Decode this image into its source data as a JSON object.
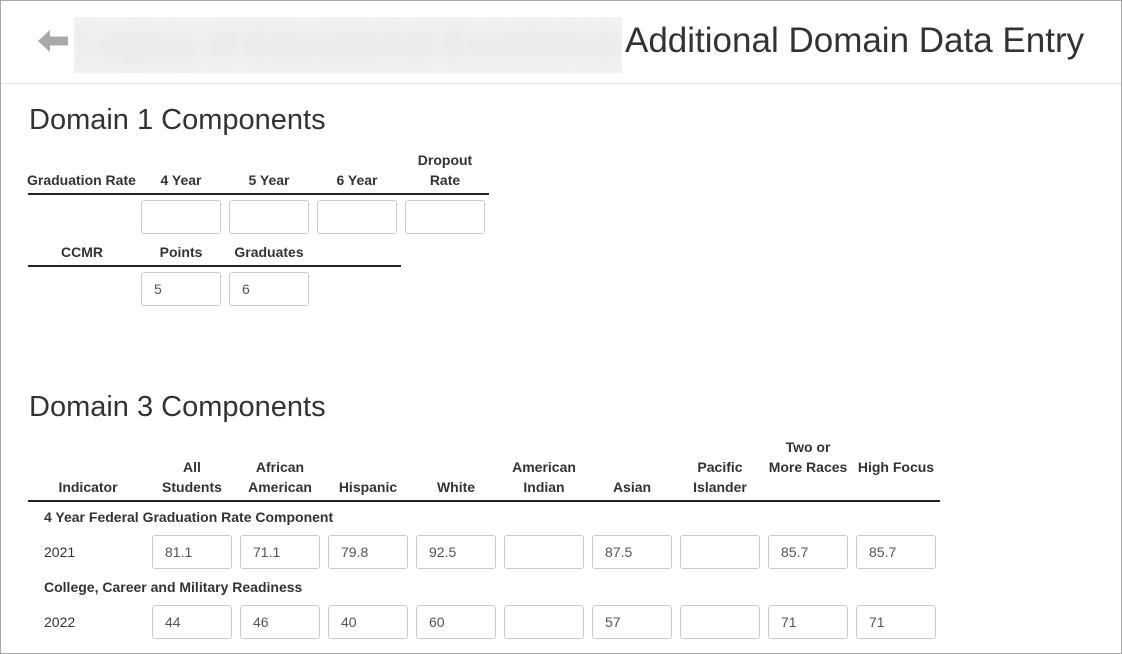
{
  "header": {
    "back_icon": "arrow-left-icon",
    "redacted_school_name": "Legacy of Educational Excellence",
    "title": "Additional Domain Data Entry"
  },
  "domain1": {
    "title": "Domain 1 Components",
    "graduation_table": {
      "headers": [
        "Graduation Rate",
        "4 Year",
        "5 Year",
        "6 Year",
        "Dropout Rate"
      ],
      "values": [
        "",
        "",
        "",
        ""
      ]
    },
    "ccmr_table": {
      "headers": [
        "CCMR",
        "Points",
        "Graduates"
      ],
      "values": [
        "5",
        "6"
      ]
    }
  },
  "domain3": {
    "title": "Domain 3 Components",
    "headers": [
      "Indicator",
      "All Students",
      "African American",
      "Hispanic",
      "White",
      "American Indian",
      "Asian",
      "Pacific Islander",
      "Two or More Races",
      "High Focus"
    ],
    "groups": [
      {
        "label": "4 Year Federal Graduation Rate Component",
        "year": "2021",
        "values": [
          "81.1",
          "71.1",
          "79.8",
          "92.5",
          "",
          "87.5",
          "",
          "85.7",
          "85.7"
        ]
      },
      {
        "label": "College, Career and Military Readiness",
        "year": "2022",
        "values": [
          "44",
          "46",
          "40",
          "60",
          "",
          "57",
          "",
          "71",
          "71"
        ]
      }
    ]
  }
}
